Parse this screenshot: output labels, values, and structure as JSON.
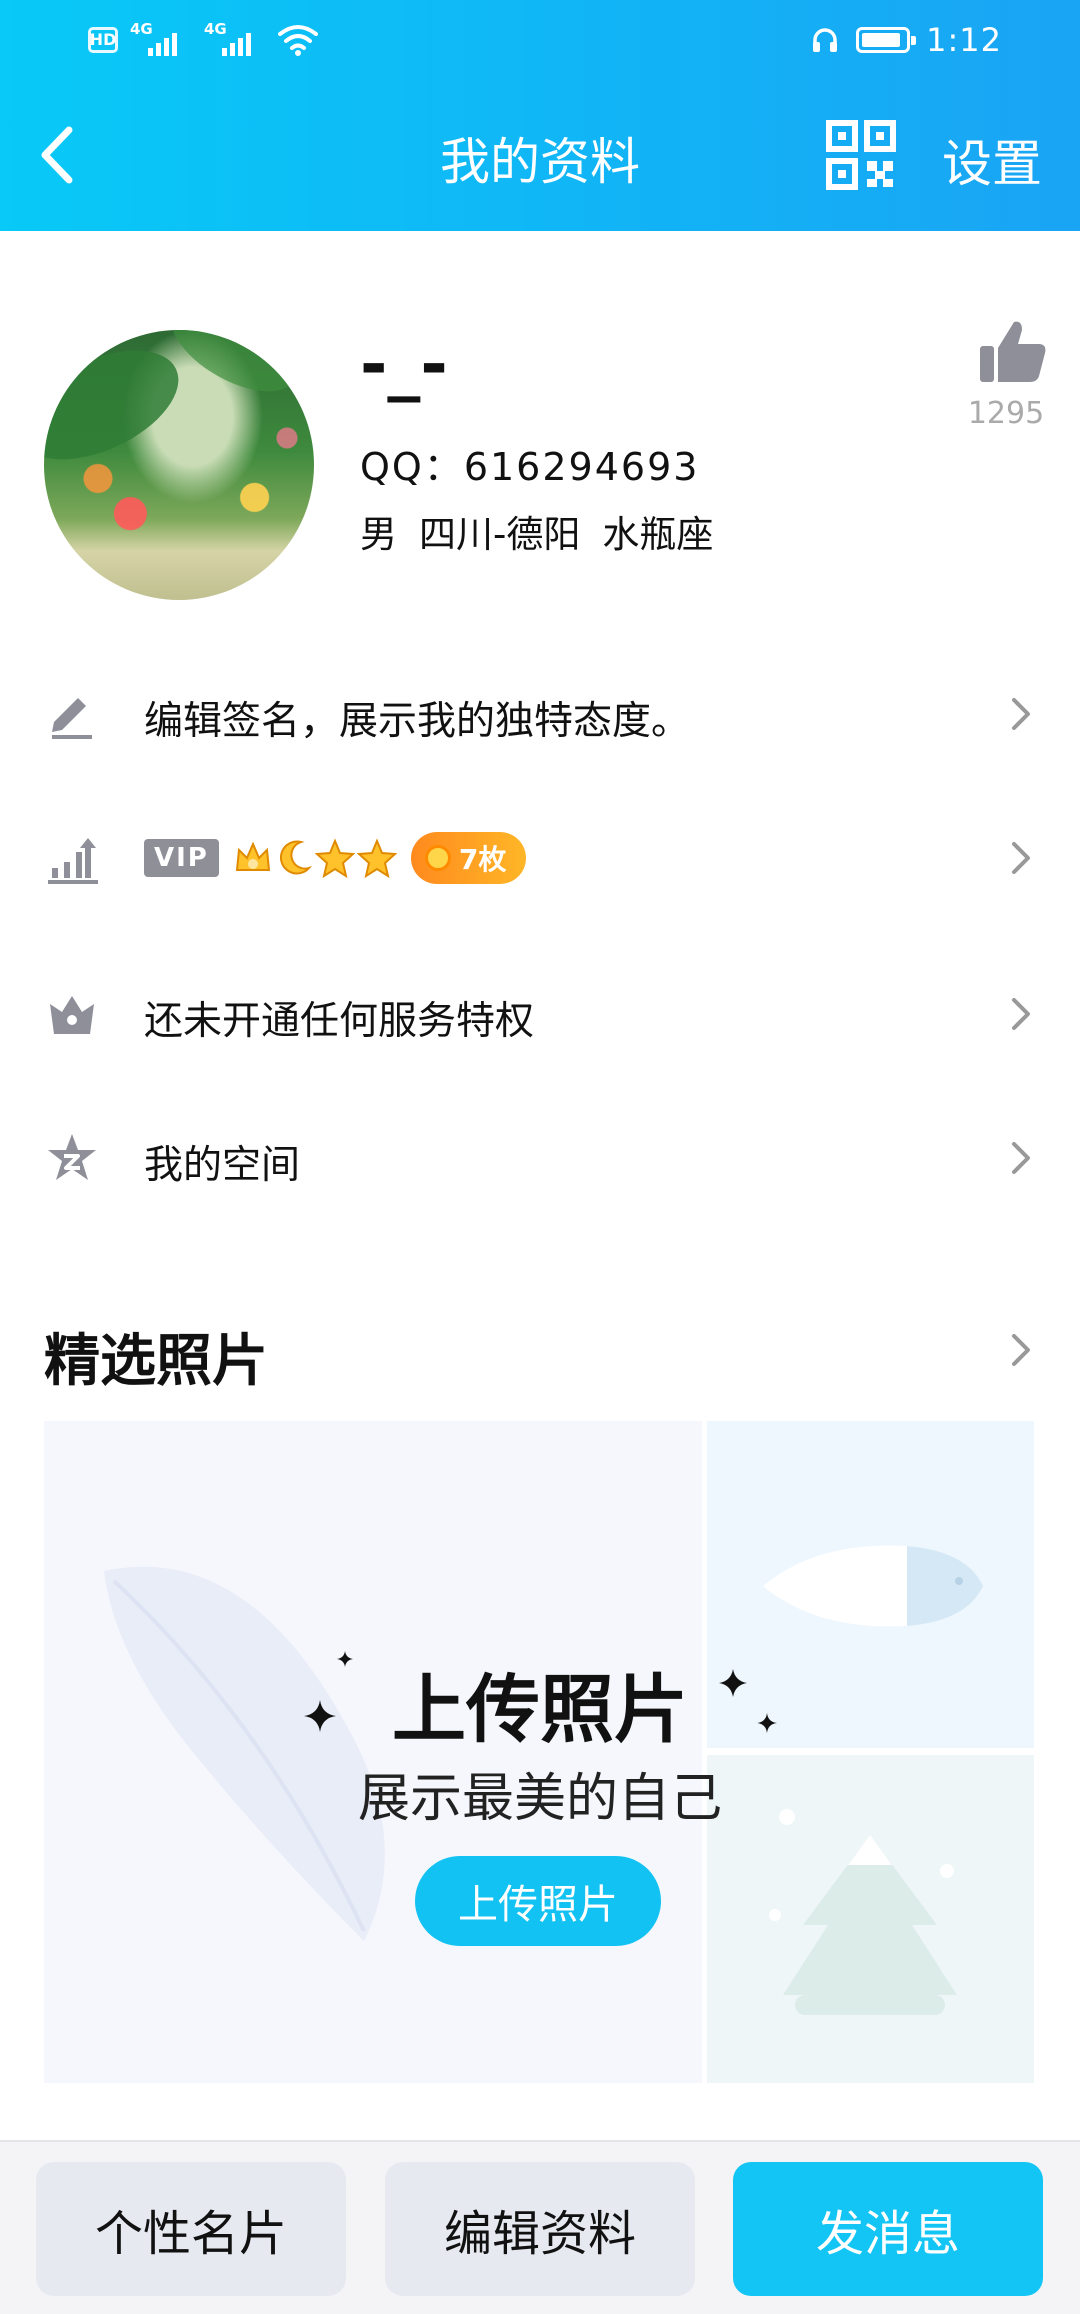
{
  "status_bar": {
    "hd": "HD",
    "network_1": "4G",
    "network_2": "4G",
    "battery_level": 0.9,
    "time": "1:12"
  },
  "nav": {
    "back_icon": "chevron-left-icon",
    "title": "我的资料",
    "qr_icon": "qr-code-icon",
    "settings_label": "设置"
  },
  "profile": {
    "nickname": "-_-",
    "qq_label": "QQ：",
    "qq_number": "616294693",
    "gender": "男",
    "location": "四川-德阳",
    "zodiac": "水瓶座",
    "likes": "1295"
  },
  "rows": [
    {
      "icon": "edit-pen-icon",
      "label": "编辑签名，展示我的独特态度。"
    },
    {
      "icon": "level-chart-icon",
      "vip_label": "VIP",
      "level_icons": [
        "crown-icon",
        "moon-icon",
        "star-icon",
        "star-icon"
      ],
      "medal_label": "7枚"
    },
    {
      "icon": "crown-service-icon",
      "label": "还未开通任何服务特权"
    },
    {
      "icon": "qzone-star-icon",
      "label": "我的空间"
    }
  ],
  "photos": {
    "section_title": "精选照片",
    "upload_title": "上传照片",
    "upload_subtitle": "展示最美的自己",
    "upload_button": "上传照片"
  },
  "bottom_bar": {
    "card_label": "个性名片",
    "edit_label": "编辑资料",
    "message_label": "发消息"
  },
  "colors": {
    "header_start": "#08c9f7",
    "header_end": "#1aa4f4",
    "primary": "#12c5f5",
    "icon_gray": "#8e8f99"
  }
}
